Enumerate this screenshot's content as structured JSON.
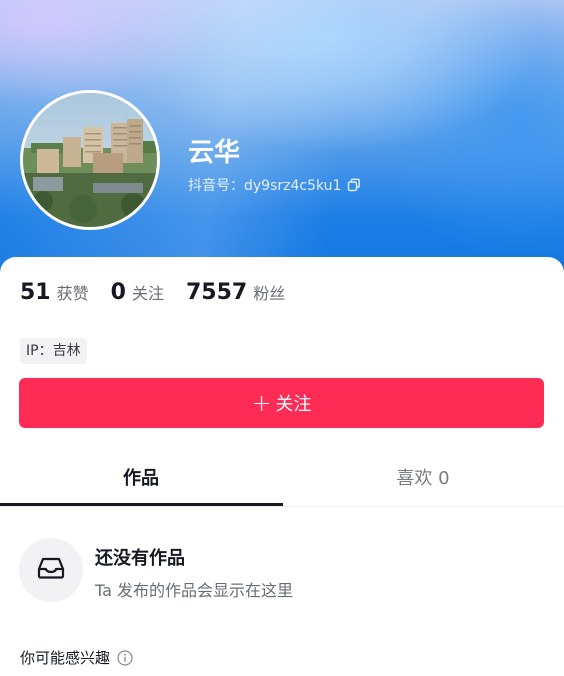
{
  "profile": {
    "username": "云华",
    "douyin_id": "抖音号：dy9srz4c5ku1"
  },
  "stats": [
    {
      "value": "51",
      "label": "获赞"
    },
    {
      "value": "0",
      "label": "关注"
    },
    {
      "value": "7557",
      "label": "粉丝"
    }
  ],
  "ip_tag": "IP：吉林",
  "follow_button": {
    "icon": "+",
    "label": "关注"
  },
  "tabs": [
    {
      "label": "作品",
      "active": true
    },
    {
      "label": "喜欢 0",
      "active": false
    }
  ],
  "empty_state": {
    "title": "还没有作品",
    "subtitle": "Ta 发布的作品会显示在这里",
    "icon": "inbox-icon"
  },
  "recommend": {
    "label": "你可能感兴趣",
    "icon": "info-icon"
  },
  "colors": {
    "accent": "#fe2c55",
    "header_blue": "#1c7ee6",
    "text_primary": "#161823",
    "text_secondary": "#6b6d76"
  }
}
